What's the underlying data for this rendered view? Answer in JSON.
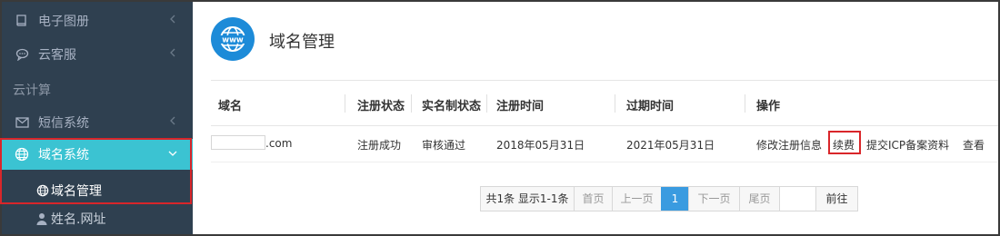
{
  "sidebar": {
    "items": [
      {
        "label": "电子图册",
        "icon": "book-icon"
      },
      {
        "label": "云客服",
        "icon": "chat-icon"
      }
    ],
    "section_label": "云计算",
    "sms": {
      "label": "短信系统",
      "icon": "mail-icon"
    },
    "domain_system": {
      "label": "域名系统",
      "icon": "globe-icon"
    },
    "sub_items": [
      {
        "label": "域名管理",
        "icon": "globe-icon"
      },
      {
        "label": "姓名.网址",
        "icon": "user-icon"
      }
    ]
  },
  "page": {
    "title": "域名管理",
    "icon_text": "www"
  },
  "table": {
    "headers": [
      "域名",
      "注册状态",
      "实名制状态",
      "注册时间",
      "过期时间",
      "操作"
    ],
    "row": {
      "domain_suffix": ".com",
      "reg_status": "注册成功",
      "realname_status": "审核通过",
      "reg_time": "2018年05月31日",
      "exp_time": "2021年05月31日",
      "actions": [
        "修改注册信息",
        "续费",
        "提交ICP备案资料",
        "查看"
      ]
    }
  },
  "pagination": {
    "summary": "共1条 显示1-1条",
    "first": "首页",
    "prev": "上一页",
    "current": "1",
    "next": "下一页",
    "last": "尾页",
    "go": "前往"
  },
  "colors": {
    "sidebar_bg": "#2f4050",
    "active_bg": "#3bc3d2",
    "highlight_red": "#d9262a",
    "page_icon_blue": "#1d8bd8",
    "pager_active": "#3a9be0"
  }
}
